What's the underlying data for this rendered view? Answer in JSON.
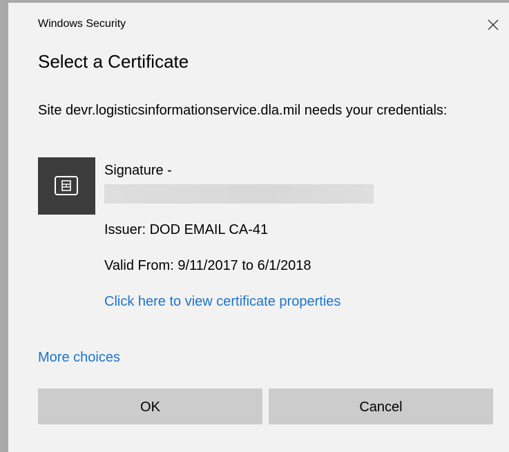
{
  "window": {
    "title": "Windows Security",
    "close_icon": "close-icon"
  },
  "dialog": {
    "heading": "Select a Certificate",
    "message": "Site devr.logisticsinformationservice.dla.mil needs your credentials:"
  },
  "certificate": {
    "icon": "certificate-card-icon",
    "name": "Signature -",
    "issuer": "Issuer: DOD EMAIL CA-41",
    "valid": "Valid From: 9/11/2017 to 6/1/2018",
    "properties_link": "Click here to view certificate properties"
  },
  "more_choices": "More choices",
  "buttons": {
    "ok": "OK",
    "cancel": "Cancel"
  },
  "colors": {
    "dialog_background": "#f2f2f2",
    "link": "#1c74cc",
    "button": "#cccccc",
    "icon_tile": "#3c3c3c"
  }
}
